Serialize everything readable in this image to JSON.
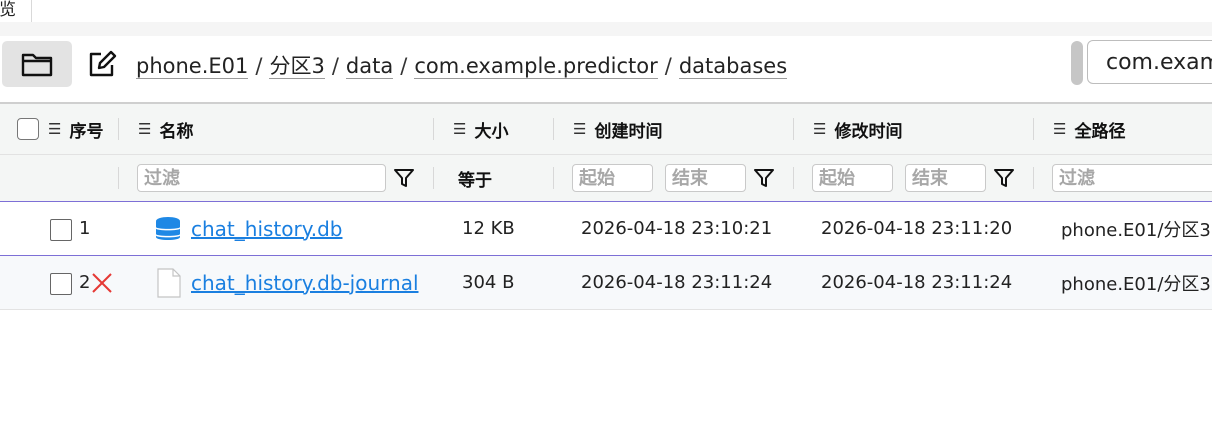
{
  "tab": {
    "label": "览"
  },
  "breadcrumb": [
    {
      "label": "phone.E01"
    },
    {
      "label": "分区3"
    },
    {
      "label": "data"
    },
    {
      "label": "com.example.predictor"
    },
    {
      "label": "databases"
    }
  ],
  "breadcrumb_separator": "/",
  "path_field": {
    "value": "com.exam"
  },
  "columns": {
    "index": "序号",
    "name": "名称",
    "size": "大小",
    "created": "创建时间",
    "modified": "修改时间",
    "full_path": "全路径"
  },
  "filters": {
    "name_placeholder": "过滤",
    "size_operator": "等于",
    "created_start_placeholder": "起始",
    "created_end_placeholder": "结束",
    "modified_start_placeholder": "起始",
    "modified_end_placeholder": "结束",
    "full_path_placeholder": "过滤"
  },
  "rows": [
    {
      "index": "1",
      "name": "chat_history.db",
      "icon": "database-icon",
      "size": "12 KB",
      "created": "2026-04-18 23:10:21",
      "modified": "2026-04-18 23:11:20",
      "full_path": "phone.E01/分区3",
      "deleted": false
    },
    {
      "index": "2",
      "name": "chat_history.db-journal",
      "icon": "file-icon",
      "size": "304 B",
      "created": "2026-04-18 23:11:24",
      "modified": "2026-04-18 23:11:24",
      "full_path": "phone.E01/分区3",
      "deleted": true
    }
  ],
  "colors": {
    "link": "#1a7fe0",
    "deleted_mark": "#e53935",
    "database_icon": "#1e88e5",
    "row_separator": "#7d6fd6"
  }
}
